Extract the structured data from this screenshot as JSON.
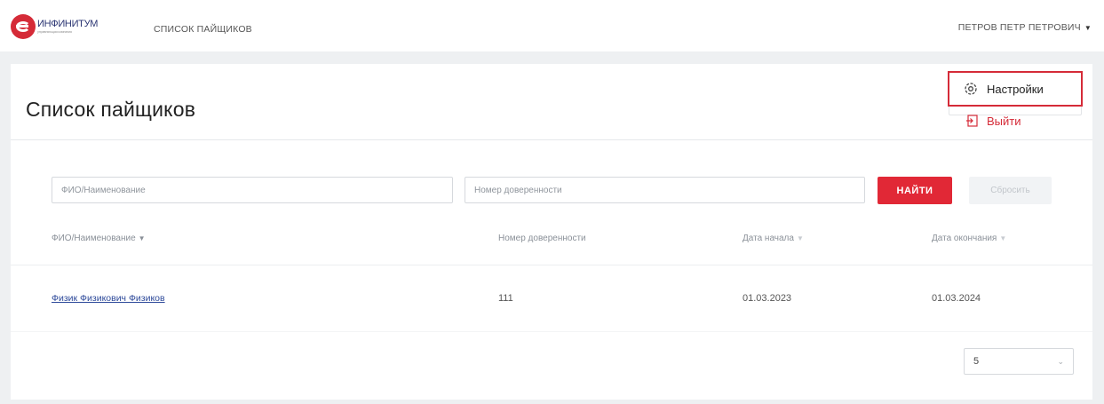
{
  "header": {
    "logo_text": "ИНФИНИТУМ",
    "logo_sub": "управляющая компания",
    "nav_label": "СПИСОК ПАЙЩИКОВ",
    "user_name": "ПЕТРОВ ПЕТР ПЕТРОВИЧ"
  },
  "user_menu": {
    "settings_label": "Настройки",
    "logout_label": "Выйти"
  },
  "page": {
    "title": "Список пайщиков"
  },
  "filters": {
    "name_placeholder": "ФИО/Наименование",
    "proxy_placeholder": "Номер доверенности",
    "find_label": "НАЙТИ",
    "reset_label": "Сбросить"
  },
  "table": {
    "columns": [
      "ФИО/Наименование",
      "Номер доверенности",
      "Дата начала",
      "Дата окончания"
    ],
    "rows": [
      [
        "Физик Физикович Физиков",
        "111",
        "01.03.2023",
        "01.03.2024"
      ]
    ]
  },
  "pagination": {
    "page_size": "5"
  },
  "colors": {
    "accent": "#e12836",
    "link": "#2e4a9a",
    "brand_blue": "#2a3472"
  }
}
